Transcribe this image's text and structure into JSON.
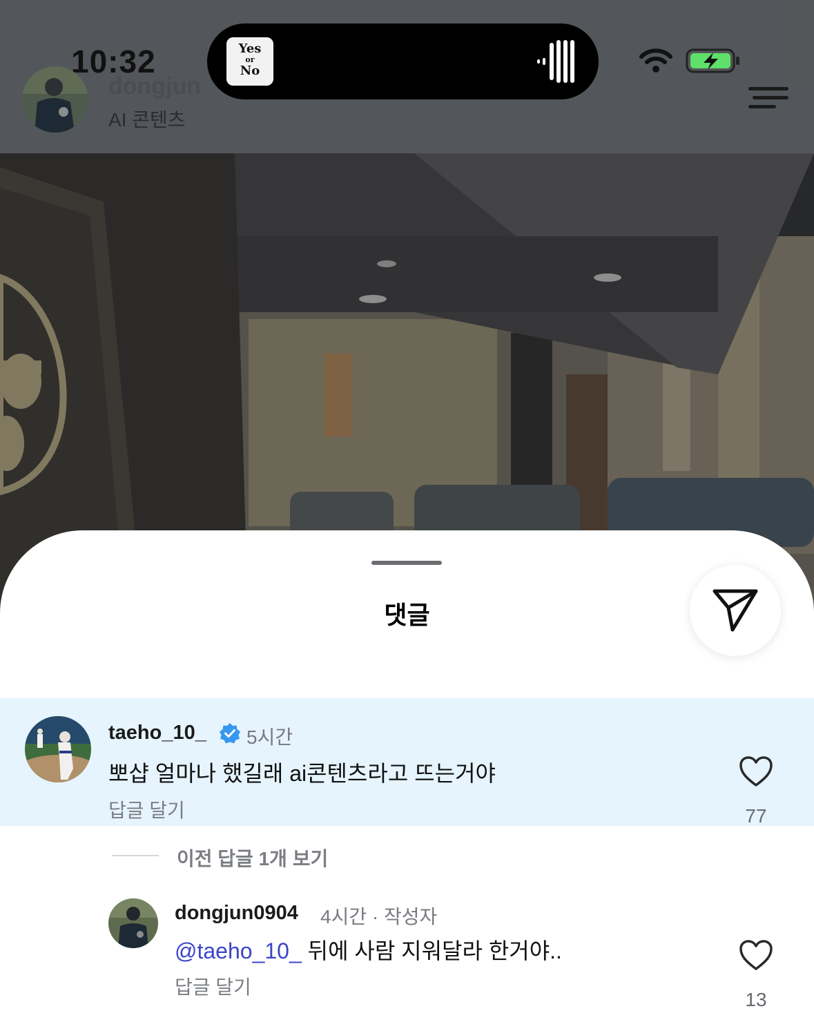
{
  "status_bar": {
    "time": "10:32",
    "now_playing_art_text": "Yes or No",
    "icons": [
      "wifi-icon",
      "battery-charging-icon",
      "audio-wave-icon"
    ],
    "battery_color": "#5ee06a"
  },
  "post": {
    "author": "dongjun",
    "subtitle": "AI 콘텐츠",
    "menu_icon": "menu-icon"
  },
  "comments_sheet": {
    "title": "댓글",
    "share_icon": "send-icon",
    "comments": [
      {
        "user": "taeho_10_",
        "verified": true,
        "time": "5시간",
        "text": "뽀샵 얼마나 했길래 ai콘텐츠라고 뜨는거야",
        "reply_label": "답글 달기",
        "likes": "77"
      }
    ],
    "view_previous_replies": "이전 답글 1개 보기",
    "reply": {
      "user": "dongjun0904",
      "time": "4시간 · 작성자",
      "mention": "@taeho_10_",
      "text": " 뒤에 사람 지워달라 한거야..",
      "reply_label": "답글 달기",
      "likes": "13"
    }
  },
  "colors": {
    "highlight": "#e6f4fe",
    "mention": "#3a45c9",
    "verified": "#3897f0"
  }
}
